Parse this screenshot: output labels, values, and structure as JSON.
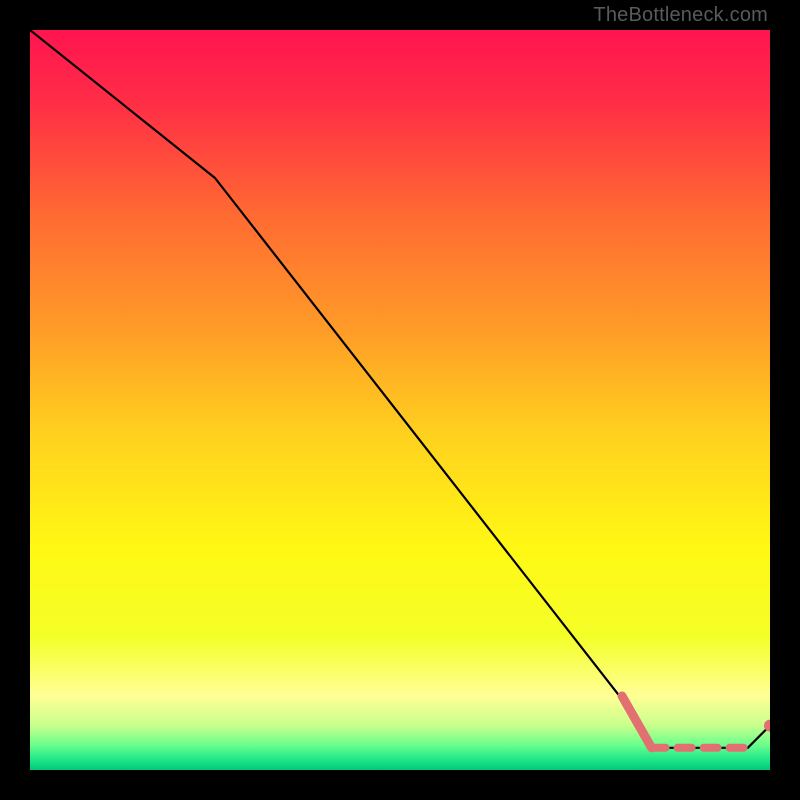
{
  "watermark": "TheBottleneck.com",
  "chart_data": {
    "type": "line",
    "title": "",
    "xlabel": "",
    "ylabel": "",
    "xlim": [
      0,
      100
    ],
    "ylim": [
      0,
      100
    ],
    "grid": false,
    "series": [
      {
        "name": "curve",
        "color": "#000000",
        "style": "solid",
        "points": [
          {
            "x": 0,
            "y": 100
          },
          {
            "x": 25,
            "y": 80
          },
          {
            "x": 82,
            "y": 7
          },
          {
            "x": 84,
            "y": 3
          },
          {
            "x": 97,
            "y": 3
          },
          {
            "x": 100,
            "y": 6
          }
        ]
      },
      {
        "name": "optimal-range",
        "color": "#e27070",
        "style": "dashed-with-lead",
        "points": [
          {
            "x": 80,
            "y": 10
          },
          {
            "x": 84,
            "y": 3
          },
          {
            "x": 97,
            "y": 3
          }
        ],
        "marker_end": {
          "x": 100,
          "y": 6
        }
      }
    ],
    "background_gradient": {
      "stops": [
        {
          "offset": 0.0,
          "color": "#ff1450"
        },
        {
          "offset": 0.1,
          "color": "#ff2e46"
        },
        {
          "offset": 0.25,
          "color": "#ff6a32"
        },
        {
          "offset": 0.4,
          "color": "#ff9a28"
        },
        {
          "offset": 0.55,
          "color": "#ffd21e"
        },
        {
          "offset": 0.7,
          "color": "#fff814"
        },
        {
          "offset": 0.82,
          "color": "#f4ff28"
        },
        {
          "offset": 0.9,
          "color": "#ffff96"
        },
        {
          "offset": 0.94,
          "color": "#c8ff8c"
        },
        {
          "offset": 0.965,
          "color": "#6eff8c"
        },
        {
          "offset": 0.985,
          "color": "#22e88a"
        },
        {
          "offset": 1.0,
          "color": "#00c87a"
        }
      ]
    }
  }
}
